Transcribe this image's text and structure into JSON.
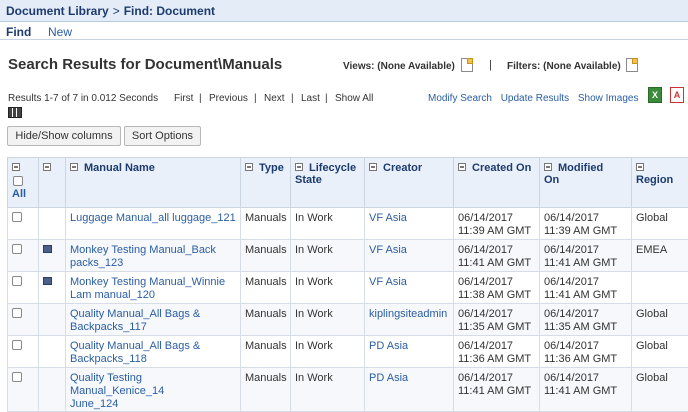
{
  "breadcrumb": {
    "root": "Document Library",
    "separator": ">",
    "current": "Find: Document"
  },
  "tabs": {
    "active": "Find",
    "inactive": "New"
  },
  "title": "Search Results for Document\\Manuals",
  "views_label": "Views: (None Available)",
  "filters_label": "Filters: (None Available)",
  "bar_separator": "|",
  "results_text": "Results 1-7 of 7 in 0.012 Seconds",
  "nav": {
    "first": "First",
    "previous": "Previous",
    "next": "Next",
    "last": "Last",
    "show_all": "Show All",
    "sep": "|"
  },
  "links": {
    "modify": "Modify Search",
    "update": "Update Results",
    "show_images": "Show Images"
  },
  "buttons": {
    "hide_show": "Hide/Show columns",
    "sort": "Sort Options"
  },
  "icons": {
    "excel": "X",
    "pdf": "A"
  },
  "table": {
    "all_label": "All",
    "headers": {
      "manual_name": "Manual Name",
      "type": "Type",
      "lifecycle_line1": "Lifecycle",
      "lifecycle_line2": "State",
      "creator": "Creator",
      "created_on": "Created On",
      "modified_line1": "Modified",
      "modified_line2": "On",
      "region": "Region"
    },
    "rows": [
      {
        "name1": "Luggage Manual_all luggage_121",
        "name2": "",
        "type": "Manuals",
        "state": "In Work",
        "creator": "VF Asia",
        "c1": "06/14/2017",
        "c2": "11:39 AM GMT",
        "m1": "06/14/2017",
        "m2": "11:39 AM GMT",
        "region": "Global"
      },
      {
        "name1": "Monkey Testing Manual_Back",
        "name2": "packs_123",
        "type": "Manuals",
        "state": "In Work",
        "creator": "VF Asia",
        "c1": "06/14/2017",
        "c2": "11:41 AM GMT",
        "m1": "06/14/2017",
        "m2": "11:41 AM GMT",
        "region": "EMEA"
      },
      {
        "name1": "Monkey Testing Manual_Winnie",
        "name2": "Lam manual_120",
        "type": "Manuals",
        "state": "In Work",
        "creator": "VF Asia",
        "c1": "06/14/2017",
        "c2": "11:38 AM GMT",
        "m1": "06/14/2017",
        "m2": "11:41 AM GMT",
        "region": ""
      },
      {
        "name1": "Quality Manual_All Bags &",
        "name2": "Backpacks_117",
        "type": "Manuals",
        "state": "In Work",
        "creator": "kiplingsiteadmin",
        "c1": "06/14/2017",
        "c2": "11:35 AM GMT",
        "m1": "06/14/2017",
        "m2": "11:35 AM GMT",
        "region": "Global"
      },
      {
        "name1": "Quality Manual_All Bags &",
        "name2": "Backpacks_118",
        "type": "Manuals",
        "state": "In Work",
        "creator": "PD Asia",
        "c1": "06/14/2017",
        "c2": "11:36 AM GMT",
        "m1": "06/14/2017",
        "m2": "11:36 AM GMT",
        "region": "Global"
      },
      {
        "name1": "Quality Testing Manual_Kenice_14",
        "name2": "June_124",
        "type": "Manuals",
        "state": "In Work",
        "creator": "PD Asia",
        "c1": "06/14/2017",
        "c2": "11:41 AM GMT",
        "m1": "06/14/2017",
        "m2": "11:41 AM GMT",
        "region": "Global"
      }
    ]
  }
}
